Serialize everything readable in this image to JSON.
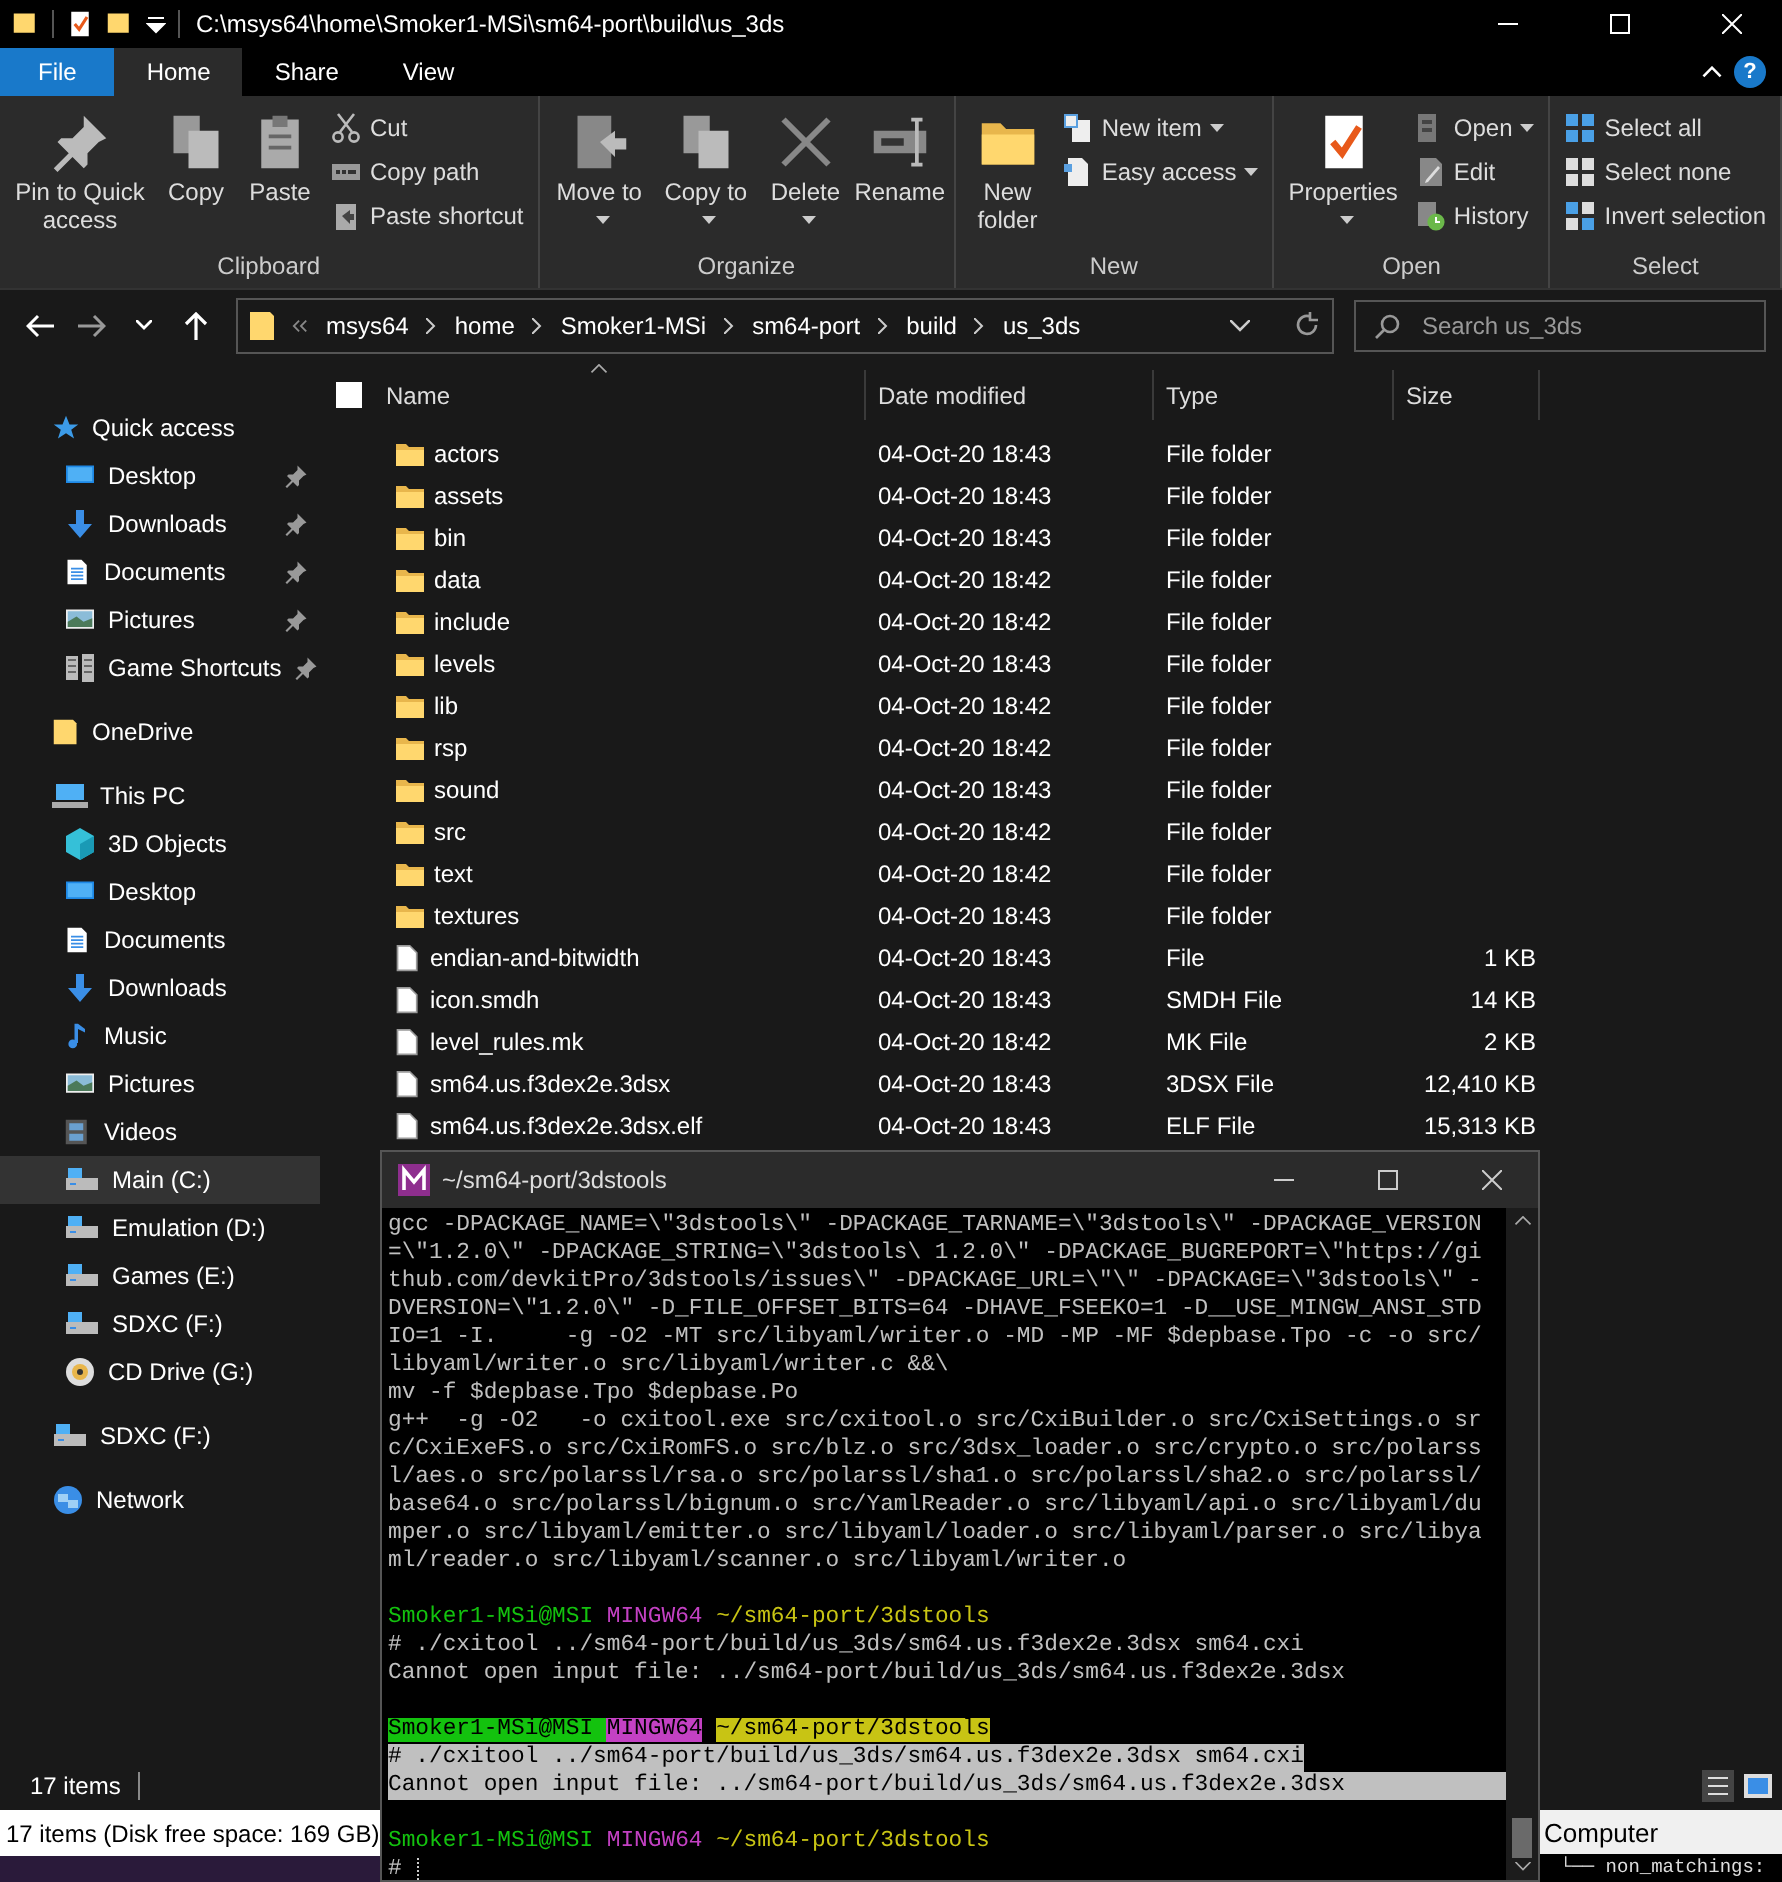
{
  "explorer": {
    "title": "C:\\msys64\\home\\Smoker1-MSi\\sm64-port\\build\\us_3ds",
    "tabs": [
      {
        "label": "File",
        "kind": "file",
        "selected": false
      },
      {
        "label": "Home",
        "kind": "tab",
        "selected": true
      },
      {
        "label": "Share",
        "kind": "tab",
        "selected": false
      },
      {
        "label": "View",
        "kind": "tab",
        "selected": false
      }
    ],
    "help": "?",
    "ribbon": [
      {
        "label": "Clipboard",
        "large": [
          {
            "label": "Pin to Quick access",
            "kind": "pin",
            "dropdown": false
          },
          {
            "label": "Copy",
            "kind": "copy",
            "dropdown": false
          },
          {
            "label": "Paste",
            "kind": "paste",
            "dropdown": false
          }
        ],
        "small": [
          {
            "label": "Cut",
            "kind": "cut",
            "dropdown": false
          },
          {
            "label": "Copy path",
            "kind": "copy-path",
            "dropdown": false
          },
          {
            "label": "Paste shortcut",
            "kind": "paste-shortcut",
            "dropdown": false
          }
        ]
      },
      {
        "label": "Organize",
        "large": [
          {
            "label": "Move to",
            "kind": "move",
            "dropdown": true
          },
          {
            "label": "Copy to",
            "kind": "copy",
            "dropdown": true
          },
          {
            "label": "Delete",
            "kind": "delete",
            "dropdown": true
          },
          {
            "label": "Rename",
            "kind": "rename",
            "dropdown": false
          }
        ]
      },
      {
        "label": "New",
        "large": [
          {
            "label": "New folder",
            "kind": "folder",
            "dropdown": false
          }
        ],
        "small": [
          {
            "label": "New item",
            "kind": "new-item",
            "dropdown": true
          },
          {
            "label": "Easy access",
            "kind": "easy-access",
            "dropdown": true
          }
        ]
      },
      {
        "label": "Open",
        "large": [
          {
            "label": "Properties",
            "kind": "properties",
            "dropdown": true
          }
        ],
        "small": [
          {
            "label": "Open",
            "kind": "open",
            "dropdown": true
          },
          {
            "label": "Edit",
            "kind": "edit",
            "dropdown": false
          },
          {
            "label": "History",
            "kind": "history",
            "dropdown": false
          }
        ]
      },
      {
        "label": "Select",
        "small": [
          {
            "label": "Select all",
            "kind": "select-all",
            "dropdown": false
          },
          {
            "label": "Select none",
            "kind": "select-none",
            "dropdown": false
          },
          {
            "label": "Invert selection",
            "kind": "invert",
            "dropdown": false
          }
        ]
      }
    ],
    "breadcrumb": [
      "msys64",
      "home",
      "Smoker1-MSi",
      "sm64-port",
      "build",
      "us_3ds"
    ],
    "search": {
      "placeholder": "Search us_3ds"
    },
    "nav": [
      {
        "label": "Quick access",
        "kind": "star",
        "selected": false,
        "children": [
          {
            "label": "Desktop",
            "kind": "desktop",
            "pinned": true,
            "selected": false
          },
          {
            "label": "Downloads",
            "kind": "download",
            "pinned": true,
            "selected": false
          },
          {
            "label": "Documents",
            "kind": "document",
            "pinned": true,
            "selected": false
          },
          {
            "label": "Pictures",
            "kind": "pictures",
            "pinned": true,
            "selected": false
          },
          {
            "label": "Game Shortcuts",
            "kind": "games",
            "pinned": true,
            "selected": false
          }
        ]
      },
      {
        "label": "OneDrive",
        "kind": "folder",
        "selected": false
      },
      {
        "label": "This PC",
        "kind": "pc",
        "selected": false,
        "children": [
          {
            "label": "3D Objects",
            "kind": "cube",
            "pinned": false,
            "selected": false
          },
          {
            "label": "Desktop",
            "kind": "desktop",
            "pinned": false,
            "selected": false
          },
          {
            "label": "Documents",
            "kind": "document",
            "pinned": false,
            "selected": false
          },
          {
            "label": "Downloads",
            "kind": "download",
            "pinned": false,
            "selected": false
          },
          {
            "label": "Music",
            "kind": "music",
            "pinned": false,
            "selected": false
          },
          {
            "label": "Pictures",
            "kind": "pictures",
            "pinned": false,
            "selected": false
          },
          {
            "label": "Videos",
            "kind": "videos",
            "pinned": false,
            "selected": false
          },
          {
            "label": "Main (C:)",
            "kind": "drive",
            "pinned": false,
            "selected": true
          },
          {
            "label": "Emulation (D:)",
            "kind": "drive",
            "pinned": false,
            "selected": false
          },
          {
            "label": "Games (E:)",
            "kind": "drive",
            "pinned": false,
            "selected": false
          },
          {
            "label": "SDXC (F:)",
            "kind": "drive",
            "pinned": false,
            "selected": false
          },
          {
            "label": "CD Drive (G:)",
            "kind": "cd",
            "pinned": false,
            "selected": false
          }
        ]
      },
      {
        "label": "SDXC (F:)",
        "kind": "drive",
        "selected": false
      },
      {
        "label": "Network",
        "kind": "network",
        "selected": false
      }
    ],
    "select_all": {
      "checked": false
    },
    "columns": [
      "Name",
      "Date modified",
      "Type",
      "Size"
    ],
    "files": [
      {
        "name": "actors",
        "kind": "folder",
        "date": "04-Oct-20 18:43",
        "type": "File folder"
      },
      {
        "name": "assets",
        "kind": "folder",
        "date": "04-Oct-20 18:43",
        "type": "File folder"
      },
      {
        "name": "bin",
        "kind": "folder",
        "date": "04-Oct-20 18:43",
        "type": "File folder"
      },
      {
        "name": "data",
        "kind": "folder",
        "date": "04-Oct-20 18:42",
        "type": "File folder"
      },
      {
        "name": "include",
        "kind": "folder",
        "date": "04-Oct-20 18:42",
        "type": "File folder"
      },
      {
        "name": "levels",
        "kind": "folder",
        "date": "04-Oct-20 18:43",
        "type": "File folder"
      },
      {
        "name": "lib",
        "kind": "folder",
        "date": "04-Oct-20 18:42",
        "type": "File folder"
      },
      {
        "name": "rsp",
        "kind": "folder",
        "date": "04-Oct-20 18:42",
        "type": "File folder"
      },
      {
        "name": "sound",
        "kind": "folder",
        "date": "04-Oct-20 18:43",
        "type": "File folder"
      },
      {
        "name": "src",
        "kind": "folder",
        "date": "04-Oct-20 18:42",
        "type": "File folder"
      },
      {
        "name": "text",
        "kind": "folder",
        "date": "04-Oct-20 18:42",
        "type": "File folder"
      },
      {
        "name": "textures",
        "kind": "folder",
        "date": "04-Oct-20 18:43",
        "type": "File folder"
      },
      {
        "name": "endian-and-bitwidth",
        "kind": "file",
        "date": "04-Oct-20 18:43",
        "type": "File",
        "size": "1 KB"
      },
      {
        "name": "icon.smdh",
        "kind": "file",
        "date": "04-Oct-20 18:43",
        "type": "SMDH File",
        "size": "14 KB"
      },
      {
        "name": "level_rules.mk",
        "kind": "file",
        "date": "04-Oct-20 18:42",
        "type": "MK File",
        "size": "2 KB"
      },
      {
        "name": "sm64.us.f3dex2e.3dsx",
        "kind": "file",
        "date": "04-Oct-20 18:43",
        "type": "3DSX File",
        "size": "12,410 KB"
      },
      {
        "name": "sm64.us.f3dex2e.3dsx.elf",
        "kind": "file",
        "date": "04-Oct-20 18:43",
        "type": "ELF File",
        "size": "15,313 KB"
      }
    ],
    "status": "17 items"
  },
  "terminal": {
    "title": "~/sm64-port/3dstools",
    "output": [
      "gcc -DPACKAGE_NAME=\\\"3dstools\\\" -DPACKAGE_TARNAME=\\\"3dstools\\\" -DPACKAGE_VERSION",
      "=\\\"1.2.0\\\" -DPACKAGE_STRING=\\\"3dstools\\ 1.2.0\\\" -DPACKAGE_BUGREPORT=\\\"https://gi",
      "thub.com/devkitPro/3dstools/issues\\\" -DPACKAGE_URL=\\\"\\\" -DPACKAGE=\\\"3dstools\\\" -",
      "DVERSION=\\\"1.2.0\\\" -D_FILE_OFFSET_BITS=64 -DHAVE_FSEEKO=1 -D__USE_MINGW_ANSI_STD",
      "IO=1 -I.     -g -O2 -MT src/libyaml/writer.o -MD -MP -MF $depbase.Tpo -c -o src/",
      "libyaml/writer.o src/libyaml/writer.c &&\\",
      "mv -f $depbase.Tpo $depbase.Po",
      "g++  -g -O2   -o cxitool.exe src/cxitool.o src/CxiBuilder.o src/CxiSettings.o sr",
      "c/CxiExeFS.o src/CxiRomFS.o src/blz.o src/3dsx_loader.o src/crypto.o src/polarss",
      "l/aes.o src/polarssl/rsa.o src/polarssl/sha1.o src/polarssl/sha2.o src/polarssl/",
      "base64.o src/polarssl/bignum.o src/YamlReader.o src/libyaml/api.o src/libyaml/du",
      "mper.o src/libyaml/emitter.o src/libyaml/loader.o src/libyaml/parser.o src/libya",
      "ml/reader.o src/libyaml/scanner.o src/libyaml/writer.o"
    ],
    "sessions": [
      {
        "user": "Smoker1-MSi@MSI",
        "shell": "MINGW64",
        "path": "~/sm64-port/3dstools",
        "command": "# ./cxitool ../sm64-port/build/us_3ds/sm64.us.f3dex2e.3dsx sm64.cxi",
        "output": "Cannot open input file: ../sm64-port/build/us_3ds/sm64.us.f3dex2e.3dsx",
        "highlighted": false
      },
      {
        "user": "Smoker1-MSi@MSI",
        "shell": "MINGW64",
        "path": "~/sm64-port/3dstools",
        "command": "# ./cxitool ../sm64-port/build/us_3ds/sm64.us.f3dex2e.3dsx sm64.cxi",
        "output": "Cannot open input file: ../sm64-port/build/us_3ds/sm64.us.f3dex2e.3dsx",
        "highlighted": true
      },
      {
        "user": "Smoker1-MSi@MSI",
        "shell": "MINGW64",
        "path": "~/sm64-port/3dstools",
        "command": "#",
        "highlighted": false
      }
    ]
  },
  "background": {
    "status": "17 items (Disk free space: 169 GB)",
    "tree_label": "Computer",
    "tree_line": "└── non_matchings:"
  }
}
